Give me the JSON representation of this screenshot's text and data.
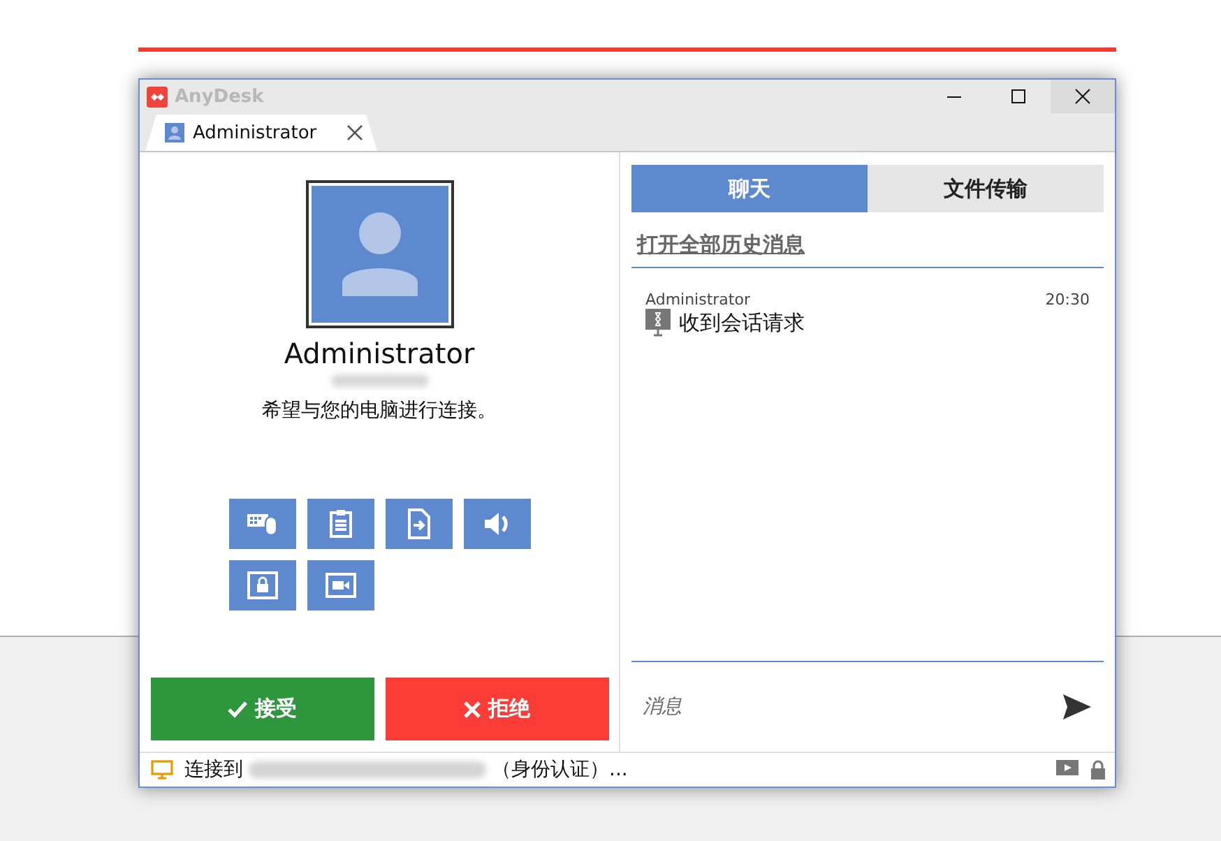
{
  "window": {
    "title": "AnyDesk"
  },
  "session_tab": {
    "label": "Administrator"
  },
  "caller": {
    "name": "Administrator",
    "message": "希望与您的电脑进行连接。"
  },
  "permissions": [
    {
      "kind": "keyboard-mouse"
    },
    {
      "kind": "clipboard"
    },
    {
      "kind": "file"
    },
    {
      "kind": "sound"
    },
    {
      "kind": "lock"
    },
    {
      "kind": "record"
    }
  ],
  "actions": [
    {
      "kind": "accept",
      "label": "接受"
    },
    {
      "kind": "reject",
      "label": "拒绝"
    }
  ],
  "chat_tabs": [
    {
      "label": "聊天",
      "selected": true
    },
    {
      "label": "文件传输",
      "selected": false
    }
  ],
  "history_link": "打开全部历史消息",
  "messages": [
    {
      "sender": "Administrator",
      "time": "20:30",
      "text": "收到会话请求"
    }
  ],
  "message_input": {
    "placeholder": "消息"
  },
  "status_bar": {
    "prefix": "连接到",
    "suffix": "（身份认证）..."
  }
}
